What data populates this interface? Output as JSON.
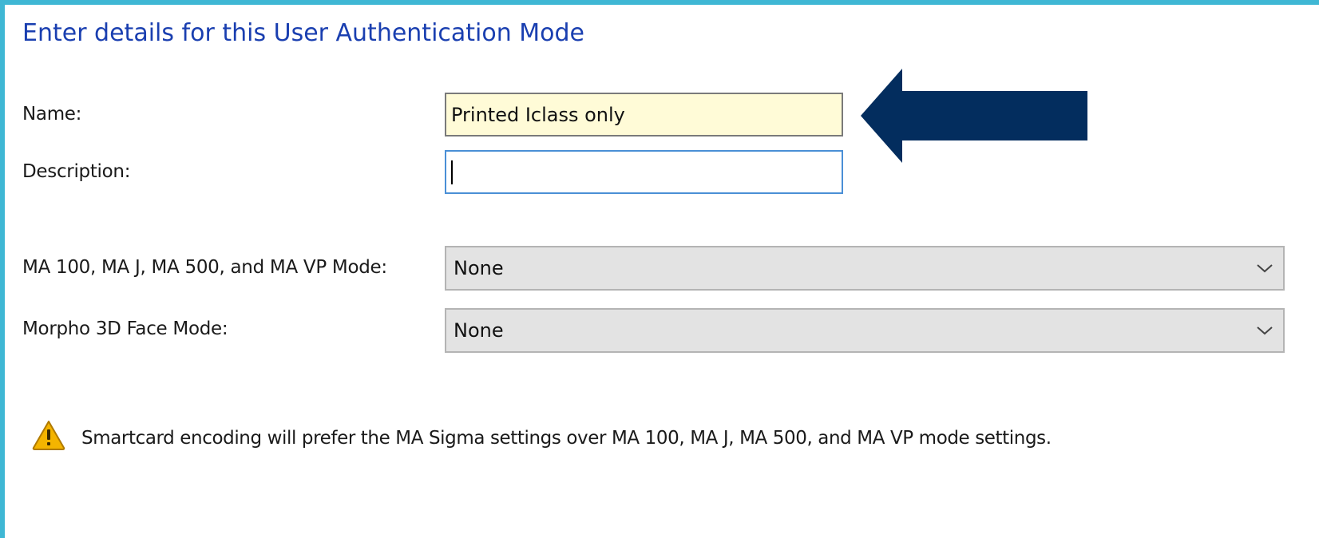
{
  "title": "Enter details for this User Authentication Mode",
  "fields": {
    "name_label": "Name:",
    "name_value": "Printed Iclass only",
    "description_label": "Description:",
    "description_value": ""
  },
  "selects": {
    "ma_mode_label": "MA 100, MA J, MA 500, and MA VP Mode:",
    "ma_mode_value": "None",
    "face_mode_label": "Morpho 3D Face Mode:",
    "face_mode_value": "None"
  },
  "warning": {
    "icon": "warning-icon",
    "text": "Smartcard encoding will prefer the MA Sigma settings over MA 100, MA J, MA 500, and MA VP mode settings."
  },
  "colors": {
    "frame": "#3fb7d4",
    "title": "#1a3fb0",
    "arrow": "#032d5e",
    "name_field_bg": "#fffbd7"
  },
  "icons": {
    "arrow": "left-arrow-icon",
    "dropdown": "chevron-down-icon"
  }
}
